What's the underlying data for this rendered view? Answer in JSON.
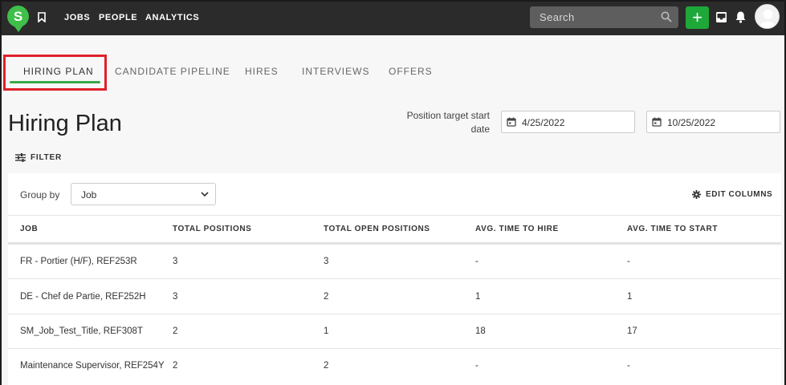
{
  "nav": {
    "logo_letter": "S",
    "links": [
      "JOBS",
      "PEOPLE",
      "ANALYTICS"
    ],
    "search_placeholder": "Search",
    "add_label": "+"
  },
  "tabs": [
    {
      "label": "HIRING PLAN",
      "active": true
    },
    {
      "label": "CANDIDATE PIPELINE",
      "active": false
    },
    {
      "label": "HIRES",
      "active": false
    },
    {
      "label": "INTERVIEWS",
      "active": false
    },
    {
      "label": "OFFERS",
      "active": false
    }
  ],
  "page": {
    "title": "Hiring Plan",
    "position_target_label": "Position target start date",
    "date_start": "4/25/2022",
    "date_end": "10/25/2022",
    "filter_label": "FILTER"
  },
  "table": {
    "group_by_label": "Group by",
    "group_by_value": "Job",
    "edit_columns_label": "EDIT COLUMNS",
    "columns": [
      "JOB",
      "TOTAL POSITIONS",
      "TOTAL OPEN POSITIONS",
      "AVG. TIME TO HIRE",
      "AVG. TIME TO START"
    ],
    "rows": [
      [
        "FR - Portier (H/F), REF253R",
        "3",
        "3",
        "-",
        "-"
      ],
      [
        "DE - Chef de Partie, REF252H",
        "3",
        "2",
        "1",
        "1"
      ],
      [
        "SM_Job_Test_Title, REF308T",
        "2",
        "1",
        "18",
        "17"
      ],
      [
        "Maintenance Supervisor, REF254Y",
        "2",
        "2",
        "-",
        "-"
      ]
    ]
  },
  "colors": {
    "topbar": "#2b2b2b",
    "brand_green": "#3fbf4a",
    "add_button": "#1fa83a",
    "tab_underline": "#3aa84a",
    "highlight_red": "#e0202a"
  }
}
